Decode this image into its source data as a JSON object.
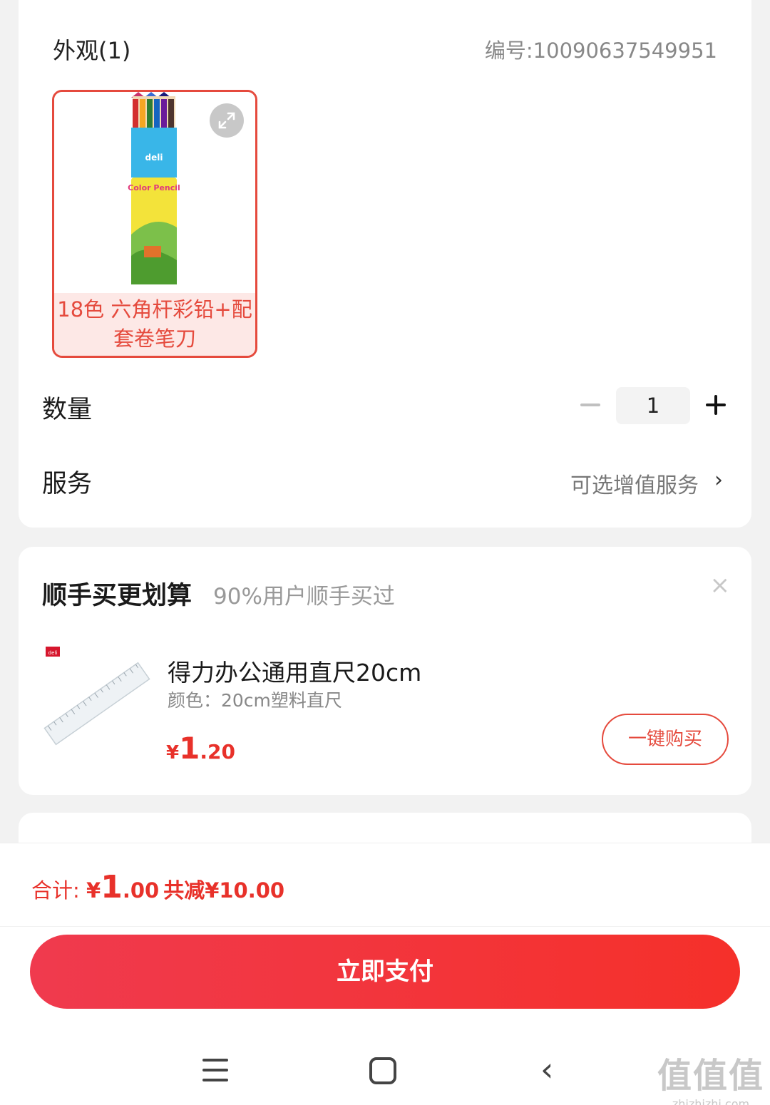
{
  "spec": {
    "title": "外观(1)",
    "code": "编号:10090637549951",
    "variant": {
      "label": "18色 六角杆彩铅+配套卷笔刀",
      "image_icon": "color-pencil-tube-icon",
      "expand_icon": "expand-icon"
    },
    "quantity_label": "数量",
    "quantity_value": "1",
    "service_label": "服务",
    "service_value": "可选增值服务",
    "service_chevron": "›"
  },
  "addon": {
    "title": "顺手买更划算",
    "subtitle": "90%用户顺手买过",
    "close": "×",
    "product": {
      "name": "得力办公通用直尺20cm",
      "attr": "颜色：20cm塑料直尺",
      "price_symbol": "¥",
      "price_int": "1",
      "price_dec": ".20",
      "brand": "deli",
      "buy_label": "一键购买"
    }
  },
  "bottom": {
    "total_prefix": "合计: ",
    "total_symbol": "¥",
    "total_int": "1",
    "total_dec": ".00",
    "saving": "共减¥10.00",
    "pay_label": "立即支付"
  },
  "navbar": {
    "back": "‹",
    "watermark_main": "值值值",
    "watermark_sub": "zhizhizhi.com"
  },
  "colors": {
    "accent": "#e54a3d",
    "price": "#e8312a",
    "pay_gradient_start": "#f03a4e",
    "pay_gradient_end": "#f5302a"
  }
}
